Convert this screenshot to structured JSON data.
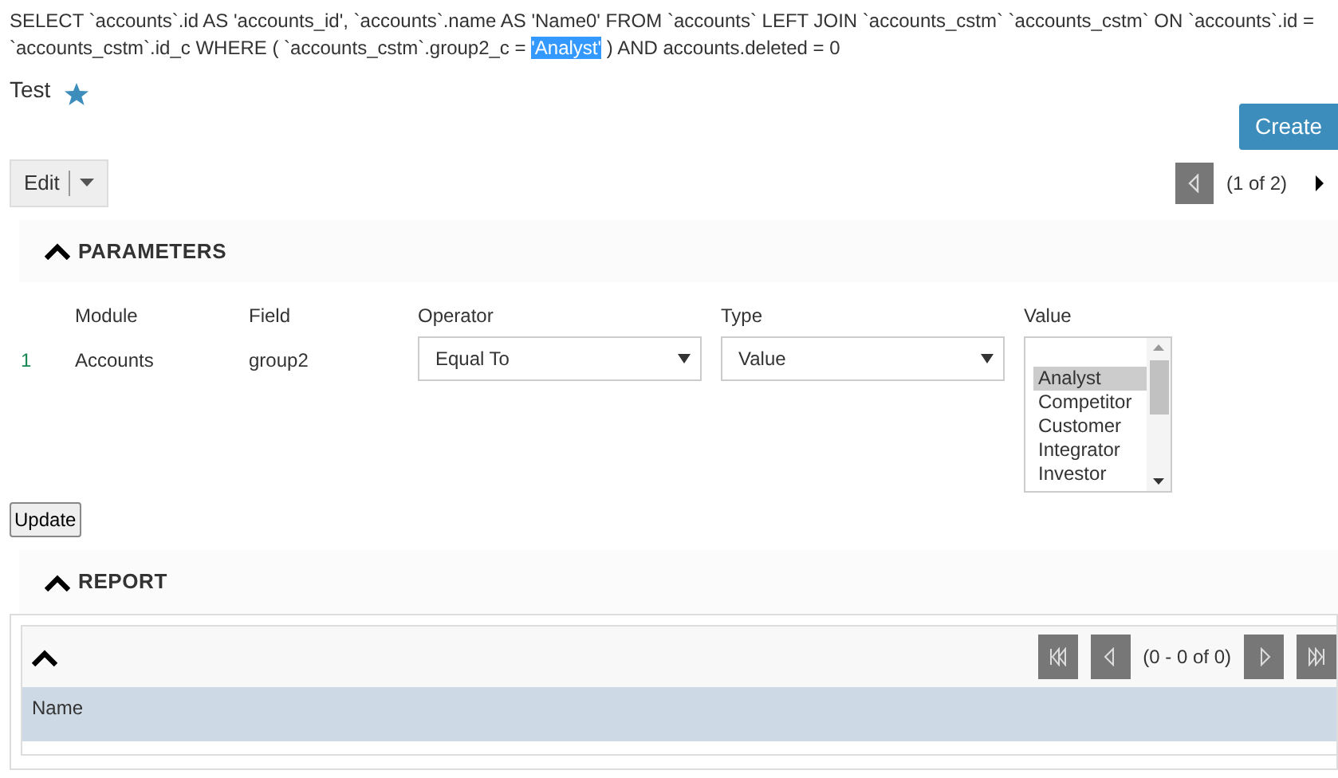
{
  "sql": {
    "before": "SELECT `accounts`.id AS 'accounts_id', `accounts`.name AS 'Name0' FROM `accounts` LEFT JOIN `accounts_cstm` `accounts_cstm` ON `accounts`.id = `accounts_cstm`.id_c WHERE ( `accounts_cstm`.group2_c = ",
    "selected": "'Analyst'",
    "after": " ) AND accounts.deleted = 0"
  },
  "title": {
    "text": "Test",
    "favorite": true
  },
  "create_button": "Create",
  "edit_button": "Edit",
  "record_pager": {
    "text": "(1 of 2)",
    "prev_disabled": true,
    "next_disabled": false
  },
  "parameters": {
    "title": "PARAMETERS",
    "expanded": true,
    "columns": [
      "Module",
      "Field",
      "Operator",
      "Type",
      "Value"
    ],
    "rows": [
      {
        "index": "1",
        "module": "Accounts",
        "field": "group2",
        "operator": "Equal To",
        "type": "Value",
        "values": [
          {
            "label": "Analyst",
            "selected": true
          },
          {
            "label": "Competitor",
            "selected": false
          },
          {
            "label": "Customer",
            "selected": false
          },
          {
            "label": "Integrator",
            "selected": false
          },
          {
            "label": "Investor",
            "selected": false
          }
        ]
      }
    ]
  },
  "update_button": "Update",
  "report": {
    "title": "REPORT",
    "expanded": true,
    "pager": "(0 - 0 of 0)",
    "columns": [
      "Name"
    ]
  }
}
